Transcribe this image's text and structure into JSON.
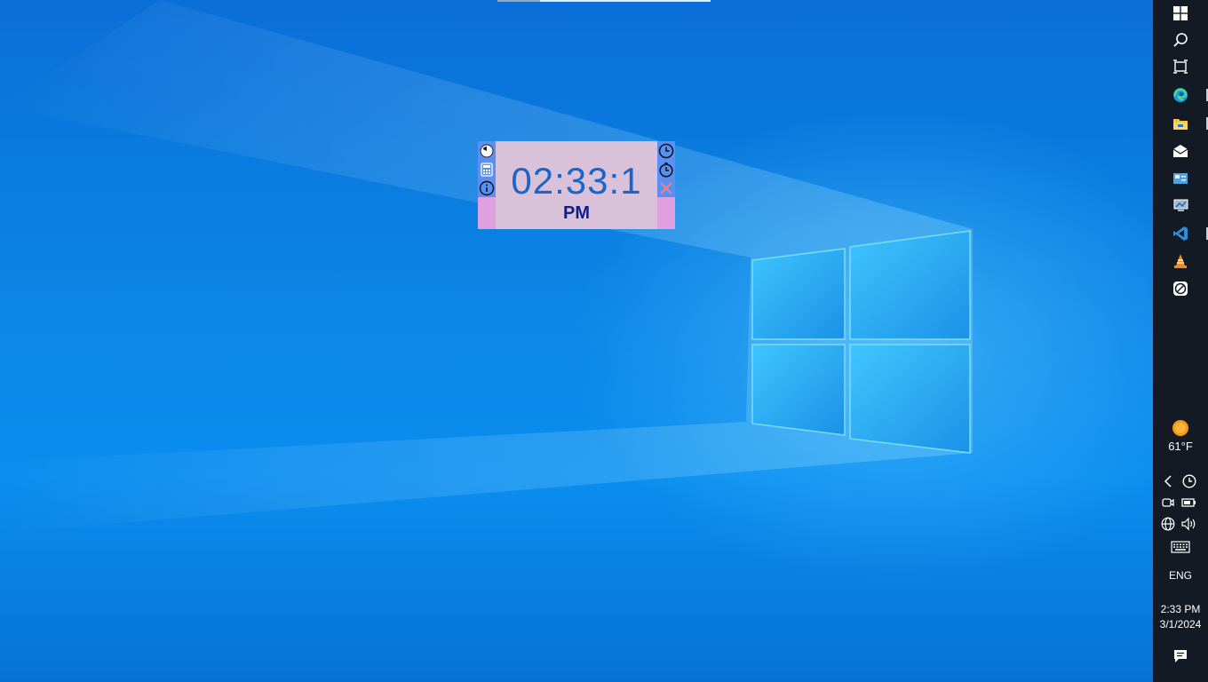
{
  "widget": {
    "time": "02:33:1",
    "ampm": "PM",
    "left_tools": [
      "timer-icon",
      "calculator-icon",
      "info-icon"
    ],
    "right_tools": [
      "clock-icon",
      "stopwatch-icon",
      "close-icon"
    ]
  },
  "taskbar": {
    "pinned": [
      "windows-start-icon",
      "search-icon",
      "task-view-icon",
      "edge-icon",
      "file-explorer-icon",
      "mail-icon",
      "control-panel-icon",
      "remote-desktop-icon",
      "vscode-icon",
      "vlc-icon",
      "app-icon"
    ],
    "weather": {
      "temperature": "61°F",
      "icon": "sun-icon"
    },
    "tray": [
      "chevron-left-icon",
      "clock-icon",
      "meet-now-icon",
      "battery-icon",
      "network-icon",
      "volume-icon",
      "keyboard-icon"
    ],
    "language": "ENG",
    "clock_time": "2:33 PM",
    "clock_date": "3/1/2024",
    "notification": "notification-icon"
  },
  "colors": {
    "desktop": "#0a86e6",
    "widget_bg": "#d9c1d9",
    "widget_side": "#e0a0e0",
    "widget_tools": "#5a8ff5",
    "time_text": "#1a66c8",
    "ampm_text": "#0f1f8a",
    "taskbar": "#141a24"
  }
}
